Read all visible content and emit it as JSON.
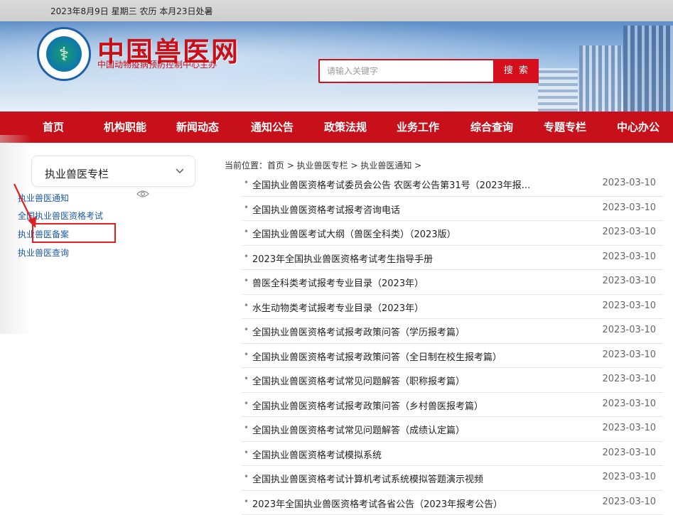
{
  "topbar": {
    "date_text": "2023年8月9日 星期三 农历 本月23日处暑"
  },
  "header": {
    "site_title": "中国兽医网",
    "site_subtitle": "中国动物疫病预防控制中心主办",
    "search_placeholder": "请输入关键字",
    "search_button": "搜 索"
  },
  "nav": {
    "items": [
      "首页",
      "机构职能",
      "新闻动态",
      "通知公告",
      "政策法规",
      "业务工作",
      "综合查询",
      "专题专栏",
      "中心办公"
    ]
  },
  "sidebar": {
    "title": "执业兽医专栏",
    "items": [
      "执业兽医通知",
      "全国执业兽医资格考试",
      "执业兽医备案",
      "执业兽医查询"
    ]
  },
  "breadcrumb": {
    "text": "当前位置：首页 > 执业兽医专栏 > 执业兽医通知 >"
  },
  "list": {
    "rows": [
      {
        "title": "全国执业兽医资格考试委员会公告 农医考公告第31号（2023年报...",
        "date": "2023-03-10"
      },
      {
        "title": "全国执业兽医资格考试报考咨询电话",
        "date": "2023-03-10"
      },
      {
        "title": "全国执业兽医考试大纲（兽医全科类）（2023版）",
        "date": "2023-03-10"
      },
      {
        "title": "2023年全国执业兽医资格考试考生指导手册",
        "date": "2023-03-10"
      },
      {
        "title": "兽医全科类考试报考专业目录（2023年）",
        "date": "2023-03-10"
      },
      {
        "title": "水生动物类考试报考专业目录（2023年）",
        "date": "2023-03-10"
      },
      {
        "title": "全国执业兽医资格考试报考政策问答（学历报考篇）",
        "date": "2023-03-10"
      },
      {
        "title": "全国执业兽医资格考试报考政策问答（全日制在校生报考篇）",
        "date": "2023-03-10"
      },
      {
        "title": "全国执业兽医资格考试常见问题解答（职称报考篇）",
        "date": "2023-03-10"
      },
      {
        "title": "全国执业兽医资格考试报考政策问答（乡村兽医报考篇）",
        "date": "2023-03-10"
      },
      {
        "title": "全国执业兽医资格考试常见问题解答（成绩认定篇）",
        "date": "2023-03-10"
      },
      {
        "title": "全国执业兽医资格考试模拟系统",
        "date": "2023-03-10"
      },
      {
        "title": "全国执业兽医资格考试计算机考试系统模拟答题演示视频",
        "date": "2023-03-10"
      },
      {
        "title": "2023年全国执业兽医资格考试各省公告（2023年报考公告）",
        "date": "2023-03-10"
      }
    ]
  },
  "colors": {
    "brand_red": "#c8101a",
    "link_blue": "#1c5ba5",
    "annotation_red": "#e02020"
  }
}
